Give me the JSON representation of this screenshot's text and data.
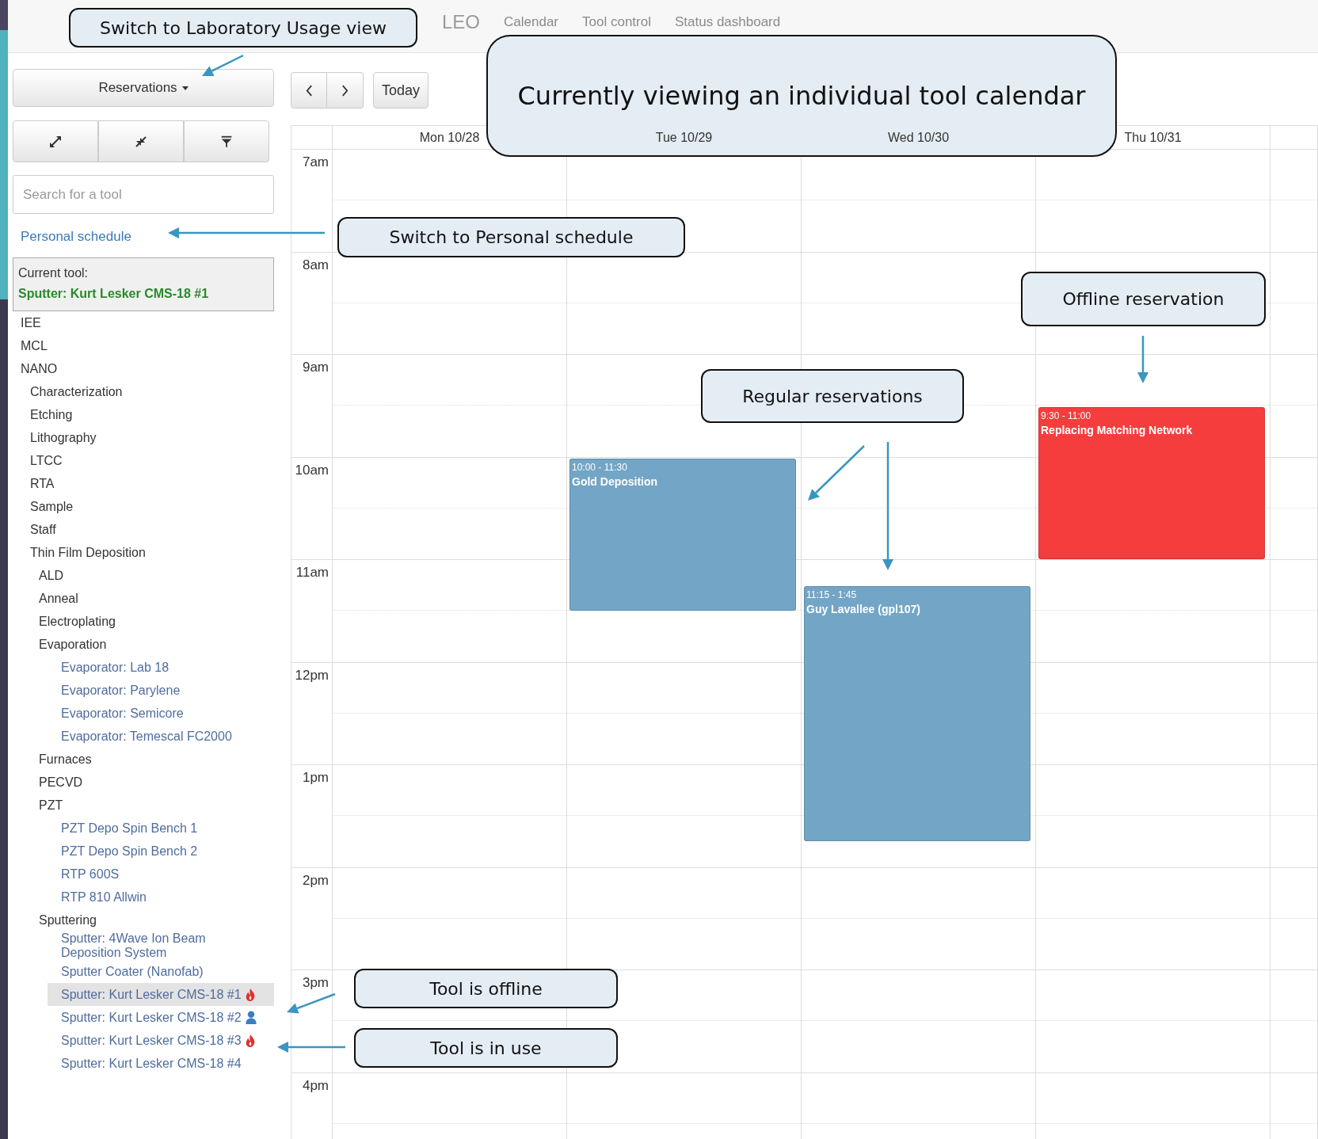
{
  "nav": {
    "brand": "LEO",
    "links": [
      {
        "label": "Calendar",
        "selected": false
      },
      {
        "label": "Tool control",
        "selected": false
      },
      {
        "label": "Status dashboard",
        "selected": false
      }
    ]
  },
  "sidebar": {
    "view_menu": {
      "label": "Reservations"
    },
    "search": {
      "placeholder": "Search for a tool"
    },
    "personal_link": "Personal schedule",
    "current_tool": {
      "label": "Current tool:",
      "name": "Sputter: Kurt Lesker CMS-18 #1"
    },
    "tree": [
      {
        "label": "IEE",
        "kind": "category",
        "selected": false
      },
      {
        "label": "MCL",
        "kind": "category",
        "selected": false
      },
      {
        "label": "NANO",
        "kind": "category",
        "selected": false,
        "children": [
          {
            "label": "Characterization",
            "kind": "category",
            "selected": false
          },
          {
            "label": "Etching",
            "kind": "category",
            "selected": false
          },
          {
            "label": "Lithography",
            "kind": "category",
            "selected": false
          },
          {
            "label": "LTCC",
            "kind": "category",
            "selected": false
          },
          {
            "label": "RTA",
            "kind": "category",
            "selected": false
          },
          {
            "label": "Sample",
            "kind": "category",
            "selected": false
          },
          {
            "label": "Staff",
            "kind": "category",
            "selected": false
          },
          {
            "label": "Thin Film Deposition",
            "kind": "category",
            "selected": false,
            "children": [
              {
                "label": "ALD",
                "kind": "category",
                "selected": false
              },
              {
                "label": "Anneal",
                "kind": "category",
                "selected": false
              },
              {
                "label": "Electroplating",
                "kind": "category",
                "selected": false
              },
              {
                "label": "Evaporation",
                "kind": "category",
                "selected": false,
                "children": [
                  {
                    "label": "Evaporator: Lab 18",
                    "kind": "tool",
                    "selected": false
                  },
                  {
                    "label": "Evaporator: Parylene",
                    "kind": "tool",
                    "selected": false
                  },
                  {
                    "label": "Evaporator: Semicore",
                    "kind": "tool",
                    "selected": false
                  },
                  {
                    "label": "Evaporator: Temescal FC2000",
                    "kind": "tool",
                    "selected": false
                  }
                ]
              },
              {
                "label": "Furnaces",
                "kind": "category",
                "selected": false
              },
              {
                "label": "PECVD",
                "kind": "category",
                "selected": false
              },
              {
                "label": "PZT",
                "kind": "category",
                "selected": false,
                "children": [
                  {
                    "label": "PZT Depo Spin Bench 1",
                    "kind": "tool",
                    "selected": false
                  },
                  {
                    "label": "PZT Depo Spin Bench 2",
                    "kind": "tool",
                    "selected": false
                  },
                  {
                    "label": "RTP 600S",
                    "kind": "tool",
                    "selected": false
                  },
                  {
                    "label": "RTP 810 Allwin",
                    "kind": "tool",
                    "selected": false
                  }
                ]
              },
              {
                "label": "Sputtering",
                "kind": "category",
                "selected": false,
                "children": [
                  {
                    "label": "Sputter: 4Wave Ion Beam Deposition System",
                    "kind": "tool",
                    "selected": false,
                    "offline": false,
                    "in_use": false
                  },
                  {
                    "label": "Sputter Coater (Nanofab)",
                    "kind": "tool",
                    "selected": false,
                    "offline": false,
                    "in_use": false
                  },
                  {
                    "label": "Sputter: Kurt Lesker CMS-18 #1",
                    "kind": "tool",
                    "selected": true,
                    "offline": true,
                    "in_use": false
                  },
                  {
                    "label": "Sputter: Kurt Lesker CMS-18 #2",
                    "kind": "tool",
                    "selected": false,
                    "offline": false,
                    "in_use": true
                  },
                  {
                    "label": "Sputter: Kurt Lesker CMS-18 #3",
                    "kind": "tool",
                    "selected": false,
                    "offline": true,
                    "in_use": false
                  },
                  {
                    "label": "Sputter: Kurt Lesker CMS-18 #4",
                    "kind": "tool",
                    "selected": false,
                    "offline": false,
                    "in_use": false
                  }
                ]
              }
            ]
          }
        ]
      }
    ]
  },
  "calendar": {
    "today_button": "Today",
    "hours": [
      "7am",
      "8am",
      "9am",
      "10am",
      "11am",
      "12pm",
      "1pm",
      "2pm",
      "3pm",
      "4pm"
    ],
    "days": [
      {
        "label": "Mon 10/28"
      },
      {
        "label": "Tue 10/29",
        "events": [
          {
            "time": "10:00 - 11:30",
            "title": "Gold Deposition",
            "color": "#73a5c6"
          }
        ]
      },
      {
        "label": "Wed 10/30",
        "events": [
          {
            "time": "11:15 - 1:45",
            "title": "Guy Lavallee (gpl107)",
            "color": "#73a5c6"
          }
        ]
      },
      {
        "label": "Thu 10/31",
        "events": [
          {
            "time": "9:30 - 11:00",
            "title": "Replacing Matching Network",
            "color": "#f53d3d"
          }
        ]
      }
    ]
  },
  "annotations": [
    {
      "text": "Switch to Laboratory Usage view"
    },
    {
      "text": "Currently viewing an individual tool calendar"
    },
    {
      "text": "Switch to Personal schedule"
    },
    {
      "text": "Offline reservation"
    },
    {
      "text": "Regular reservations"
    },
    {
      "text": "Tool is offline"
    },
    {
      "text": "Tool is in use"
    }
  ]
}
